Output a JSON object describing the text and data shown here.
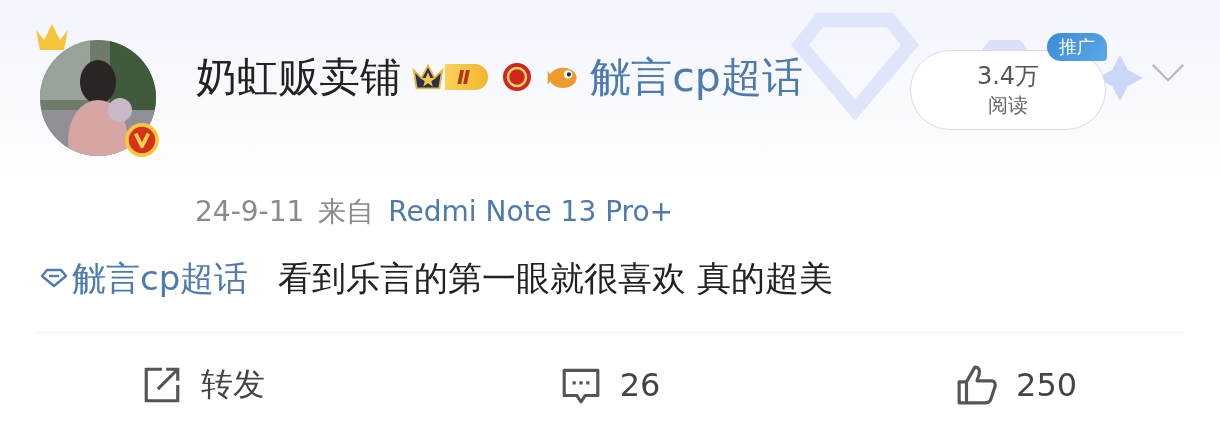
{
  "author": {
    "name": "奶虹贩卖铺",
    "level_badge": "Ⅱ",
    "topic": "觥言cp超话",
    "verified": true
  },
  "read_count": {
    "value": "3.4万",
    "label": "阅读",
    "tag": "推广"
  },
  "meta": {
    "date": "24-9-11",
    "source_prefix": "来自",
    "source": "Redmi Note 13 Pro+"
  },
  "content": {
    "topic": "觥言cp超话",
    "text": "看到乐言的第一眼就很喜欢 真的超美"
  },
  "actions": [
    {
      "kind": "repost",
      "label": "转发"
    },
    {
      "kind": "comment",
      "label": "26"
    },
    {
      "kind": "like",
      "label": "250"
    }
  ]
}
